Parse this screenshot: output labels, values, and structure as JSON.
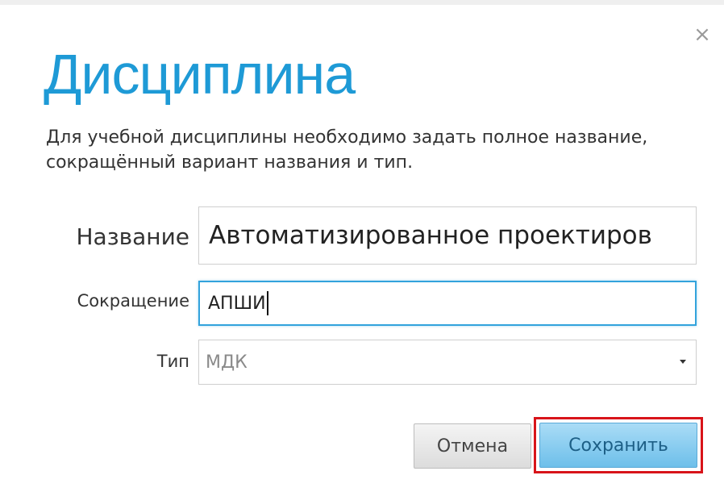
{
  "dialog": {
    "title": "Дисциплина",
    "description": "Для учебной дисциплины необходимо задать полное название, сокращённый вариант названия и тип.",
    "close_glyph": "×"
  },
  "form": {
    "name": {
      "label": "Название",
      "value": "Автоматизированное проектиров"
    },
    "short": {
      "label": "Сокращение",
      "value": "АПШИ"
    },
    "type": {
      "label": "Тип",
      "selected": "МДК"
    }
  },
  "buttons": {
    "cancel_label": "Отмена",
    "save_label": "Сохранить"
  },
  "icons": {
    "close": "close-icon",
    "dropdown": "chevron-down-icon"
  },
  "colors": {
    "title": "#1e9ad6",
    "focus_border": "#33a3dc",
    "save_button": "#8fd0f1",
    "highlight": "#d8141a"
  }
}
